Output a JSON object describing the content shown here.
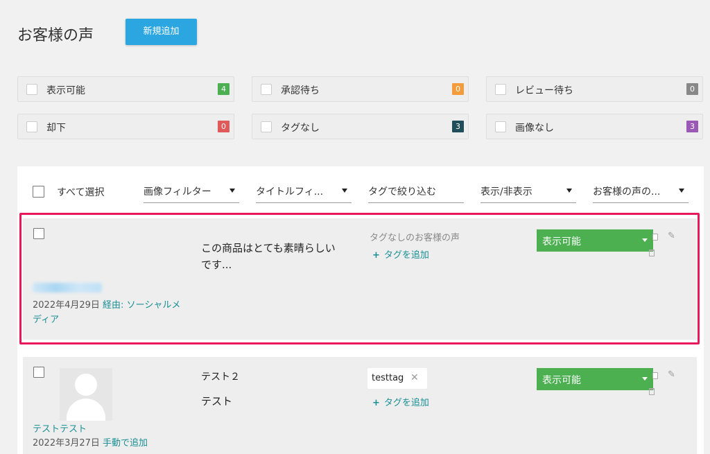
{
  "header": {
    "title": "お客様の声",
    "add_new_label": "新規追加"
  },
  "filters": [
    {
      "label": "表示可能",
      "count": "4",
      "color": "#4caf50"
    },
    {
      "label": "承認待ち",
      "count": "0",
      "color": "#f39c3b"
    },
    {
      "label": "レビュー待ち",
      "count": "0",
      "color": "#888888"
    },
    {
      "label": "却下",
      "count": "0",
      "color": "#e05a5a"
    },
    {
      "label": "タグなし",
      "count": "3",
      "color": "#1f4e5a"
    },
    {
      "label": "画像なし",
      "count": "3",
      "color": "#9b59b6"
    }
  ],
  "toolbar": {
    "select_all_label": "すべて選択",
    "image_filter": "画像フィルター",
    "title_filter": "タイトルフィ...",
    "tag_filter": "タグで絞り込む",
    "visibility_filter": "表示/非表示",
    "voice_filter": "お客様の声の..."
  },
  "reviews": [
    {
      "date": "2022年4月29日",
      "source_prefix": "経由:",
      "source": "ソーシャルメ",
      "source_cont": "ディア",
      "text_line1": "この商品はとても素晴らしい",
      "text_line2": "です...",
      "tags_empty": "タグなしのお客様の声",
      "add_tag": "タグを追加",
      "status": "表示可能"
    },
    {
      "author": "テストテスト",
      "date": "2022年3月27日",
      "source": "手動で追加",
      "title": "テスト２",
      "text": "テスト",
      "tag": "testtag",
      "add_tag": "タグを追加",
      "status": "表示可能"
    }
  ],
  "colors": {
    "accent": "#2ba6e1",
    "status_green": "#4caf50",
    "highlight": "#e8195a",
    "link": "#1a8f94"
  },
  "icons": {
    "copy": "copy-icon",
    "edit": "pencil-icon",
    "delete": "trash-icon",
    "add": "plus-icon",
    "remove_tag": "close-icon",
    "avatar": "user-avatar-icon"
  }
}
